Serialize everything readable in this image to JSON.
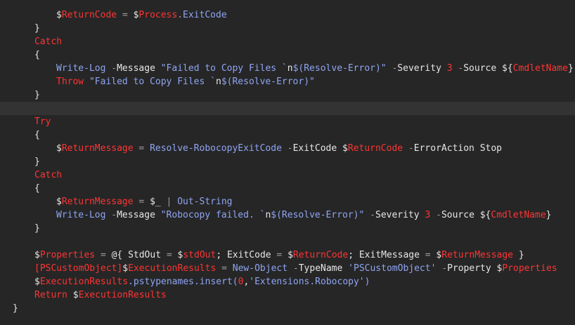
{
  "editor": {
    "theme_colors": {
      "background": "#262626",
      "current_line": "#333333",
      "plain": "#e6e6e6",
      "variable": "#ff3434",
      "keyword": "#ff3434",
      "string_and_command": "#8fa5f3"
    },
    "lines": [
      {
        "indent": 8,
        "tokens": [
          [
            "varsign",
            "$"
          ],
          [
            "var",
            "ReturnCode"
          ],
          [
            "plain",
            " "
          ],
          [
            "op",
            "="
          ],
          [
            "plain",
            " "
          ],
          [
            "varsign",
            "$"
          ],
          [
            "var",
            "Process"
          ],
          [
            "op",
            "."
          ],
          [
            "cmd",
            "ExitCode"
          ]
        ]
      },
      {
        "indent": 4,
        "tokens": [
          [
            "brace",
            "}"
          ]
        ]
      },
      {
        "indent": 4,
        "tokens": [
          [
            "keyword",
            "Catch"
          ]
        ]
      },
      {
        "indent": 4,
        "tokens": [
          [
            "brace",
            "{"
          ]
        ]
      },
      {
        "indent": 8,
        "tokens": [
          [
            "cmd",
            "Write-Log"
          ],
          [
            "plain",
            " "
          ],
          [
            "op",
            "-"
          ],
          [
            "param",
            "Message"
          ],
          [
            "plain",
            " "
          ],
          [
            "string",
            "\"Failed to Copy Files `"
          ],
          [
            "plain",
            "n"
          ],
          [
            "string",
            "$(Resolve-Error)\""
          ],
          [
            "plain",
            " "
          ],
          [
            "op",
            "-"
          ],
          [
            "param",
            "Severity"
          ],
          [
            "plain",
            " "
          ],
          [
            "number",
            "3"
          ],
          [
            "plain",
            " "
          ],
          [
            "op",
            "-"
          ],
          [
            "param",
            "Source"
          ],
          [
            "plain",
            " "
          ],
          [
            "varsign",
            "${"
          ],
          [
            "var",
            "CmdletName"
          ],
          [
            "varsign",
            "}"
          ]
        ]
      },
      {
        "indent": 8,
        "tokens": [
          [
            "keyword",
            "Throw"
          ],
          [
            "plain",
            " "
          ],
          [
            "string",
            "\"Failed to Copy Files `"
          ],
          [
            "plain",
            "n"
          ],
          [
            "string",
            "$(Resolve-Error)\""
          ]
        ]
      },
      {
        "indent": 4,
        "tokens": [
          [
            "brace",
            "}"
          ]
        ]
      },
      {
        "indent": 0,
        "current": true,
        "tokens": []
      },
      {
        "indent": 4,
        "tokens": [
          [
            "keyword",
            "Try"
          ]
        ]
      },
      {
        "indent": 4,
        "tokens": [
          [
            "brace",
            "{"
          ]
        ]
      },
      {
        "indent": 8,
        "tokens": [
          [
            "varsign",
            "$"
          ],
          [
            "var",
            "ReturnMessage"
          ],
          [
            "plain",
            " "
          ],
          [
            "op",
            "="
          ],
          [
            "plain",
            " "
          ],
          [
            "cmd",
            "Resolve-RobocopyExitCode"
          ],
          [
            "plain",
            " "
          ],
          [
            "op",
            "-"
          ],
          [
            "param",
            "ExitCode"
          ],
          [
            "plain",
            " "
          ],
          [
            "varsign",
            "$"
          ],
          [
            "var",
            "ReturnCode"
          ],
          [
            "plain",
            " "
          ],
          [
            "op",
            "-"
          ],
          [
            "param",
            "ErrorAction"
          ],
          [
            "plain",
            " Stop"
          ]
        ]
      },
      {
        "indent": 4,
        "tokens": [
          [
            "brace",
            "}"
          ]
        ]
      },
      {
        "indent": 4,
        "tokens": [
          [
            "keyword",
            "Catch"
          ]
        ]
      },
      {
        "indent": 4,
        "tokens": [
          [
            "brace",
            "{"
          ]
        ]
      },
      {
        "indent": 8,
        "tokens": [
          [
            "varsign",
            "$"
          ],
          [
            "var",
            "ReturnMessage"
          ],
          [
            "plain",
            " "
          ],
          [
            "op",
            "="
          ],
          [
            "plain",
            " "
          ],
          [
            "varsign",
            "$_"
          ],
          [
            "plain",
            " "
          ],
          [
            "op",
            "|"
          ],
          [
            "plain",
            " "
          ],
          [
            "cmd",
            "Out-String"
          ]
        ]
      },
      {
        "indent": 8,
        "tokens": [
          [
            "cmd",
            "Write-Log"
          ],
          [
            "plain",
            " "
          ],
          [
            "op",
            "-"
          ],
          [
            "param",
            "Message"
          ],
          [
            "plain",
            " "
          ],
          [
            "string",
            "\"Robocopy failed. `"
          ],
          [
            "plain",
            "n"
          ],
          [
            "string",
            "$(Resolve-Error)\""
          ],
          [
            "plain",
            " "
          ],
          [
            "op",
            "-"
          ],
          [
            "param",
            "Severity"
          ],
          [
            "plain",
            " "
          ],
          [
            "number",
            "3"
          ],
          [
            "plain",
            " "
          ],
          [
            "op",
            "-"
          ],
          [
            "param",
            "Source"
          ],
          [
            "plain",
            " "
          ],
          [
            "varsign",
            "${"
          ],
          [
            "var",
            "CmdletName"
          ],
          [
            "varsign",
            "}"
          ]
        ]
      },
      {
        "indent": 4,
        "tokens": [
          [
            "brace",
            "}"
          ]
        ]
      },
      {
        "indent": 0,
        "tokens": []
      },
      {
        "indent": 4,
        "tokens": [
          [
            "varsign",
            "$"
          ],
          [
            "var",
            "Properties"
          ],
          [
            "plain",
            " "
          ],
          [
            "op",
            "="
          ],
          [
            "plain",
            " "
          ],
          [
            "plain",
            "@{ StdOut "
          ],
          [
            "op",
            "="
          ],
          [
            "plain",
            " "
          ],
          [
            "varsign",
            "$"
          ],
          [
            "var",
            "stdOut"
          ],
          [
            "plain",
            "; ExitCode "
          ],
          [
            "op",
            "="
          ],
          [
            "plain",
            " "
          ],
          [
            "varsign",
            "$"
          ],
          [
            "var",
            "ReturnCode"
          ],
          [
            "plain",
            "; ExitMessage "
          ],
          [
            "op",
            "="
          ],
          [
            "plain",
            " "
          ],
          [
            "varsign",
            "$"
          ],
          [
            "var",
            "ReturnMessage"
          ],
          [
            "plain",
            " }"
          ]
        ]
      },
      {
        "indent": 4,
        "tokens": [
          [
            "type",
            "[PSCustomObject]"
          ],
          [
            "varsign",
            "$"
          ],
          [
            "var",
            "ExecutionResults"
          ],
          [
            "plain",
            " "
          ],
          [
            "op",
            "="
          ],
          [
            "plain",
            " "
          ],
          [
            "cmd",
            "New-Object"
          ],
          [
            "plain",
            " "
          ],
          [
            "op",
            "-"
          ],
          [
            "param",
            "TypeName"
          ],
          [
            "plain",
            " "
          ],
          [
            "string",
            "'PSCustomObject'"
          ],
          [
            "plain",
            " "
          ],
          [
            "op",
            "-"
          ],
          [
            "param",
            "Property"
          ],
          [
            "plain",
            " "
          ],
          [
            "varsign",
            "$"
          ],
          [
            "var",
            "Properties"
          ]
        ]
      },
      {
        "indent": 4,
        "tokens": [
          [
            "varsign",
            "$"
          ],
          [
            "var",
            "ExecutionResults"
          ],
          [
            "cmd",
            ".pstypenames.insert("
          ],
          [
            "number",
            "0"
          ],
          [
            "plain",
            ","
          ],
          [
            "string",
            "'Extensions.Robocopy'"
          ],
          [
            "cmd",
            ")"
          ]
        ]
      },
      {
        "indent": 4,
        "tokens": [
          [
            "keyword",
            "Return"
          ],
          [
            "plain",
            " "
          ],
          [
            "varsign",
            "$"
          ],
          [
            "var",
            "ExecutionResults"
          ]
        ]
      },
      {
        "indent": 0,
        "tokens": [
          [
            "brace",
            "}"
          ]
        ]
      }
    ]
  }
}
